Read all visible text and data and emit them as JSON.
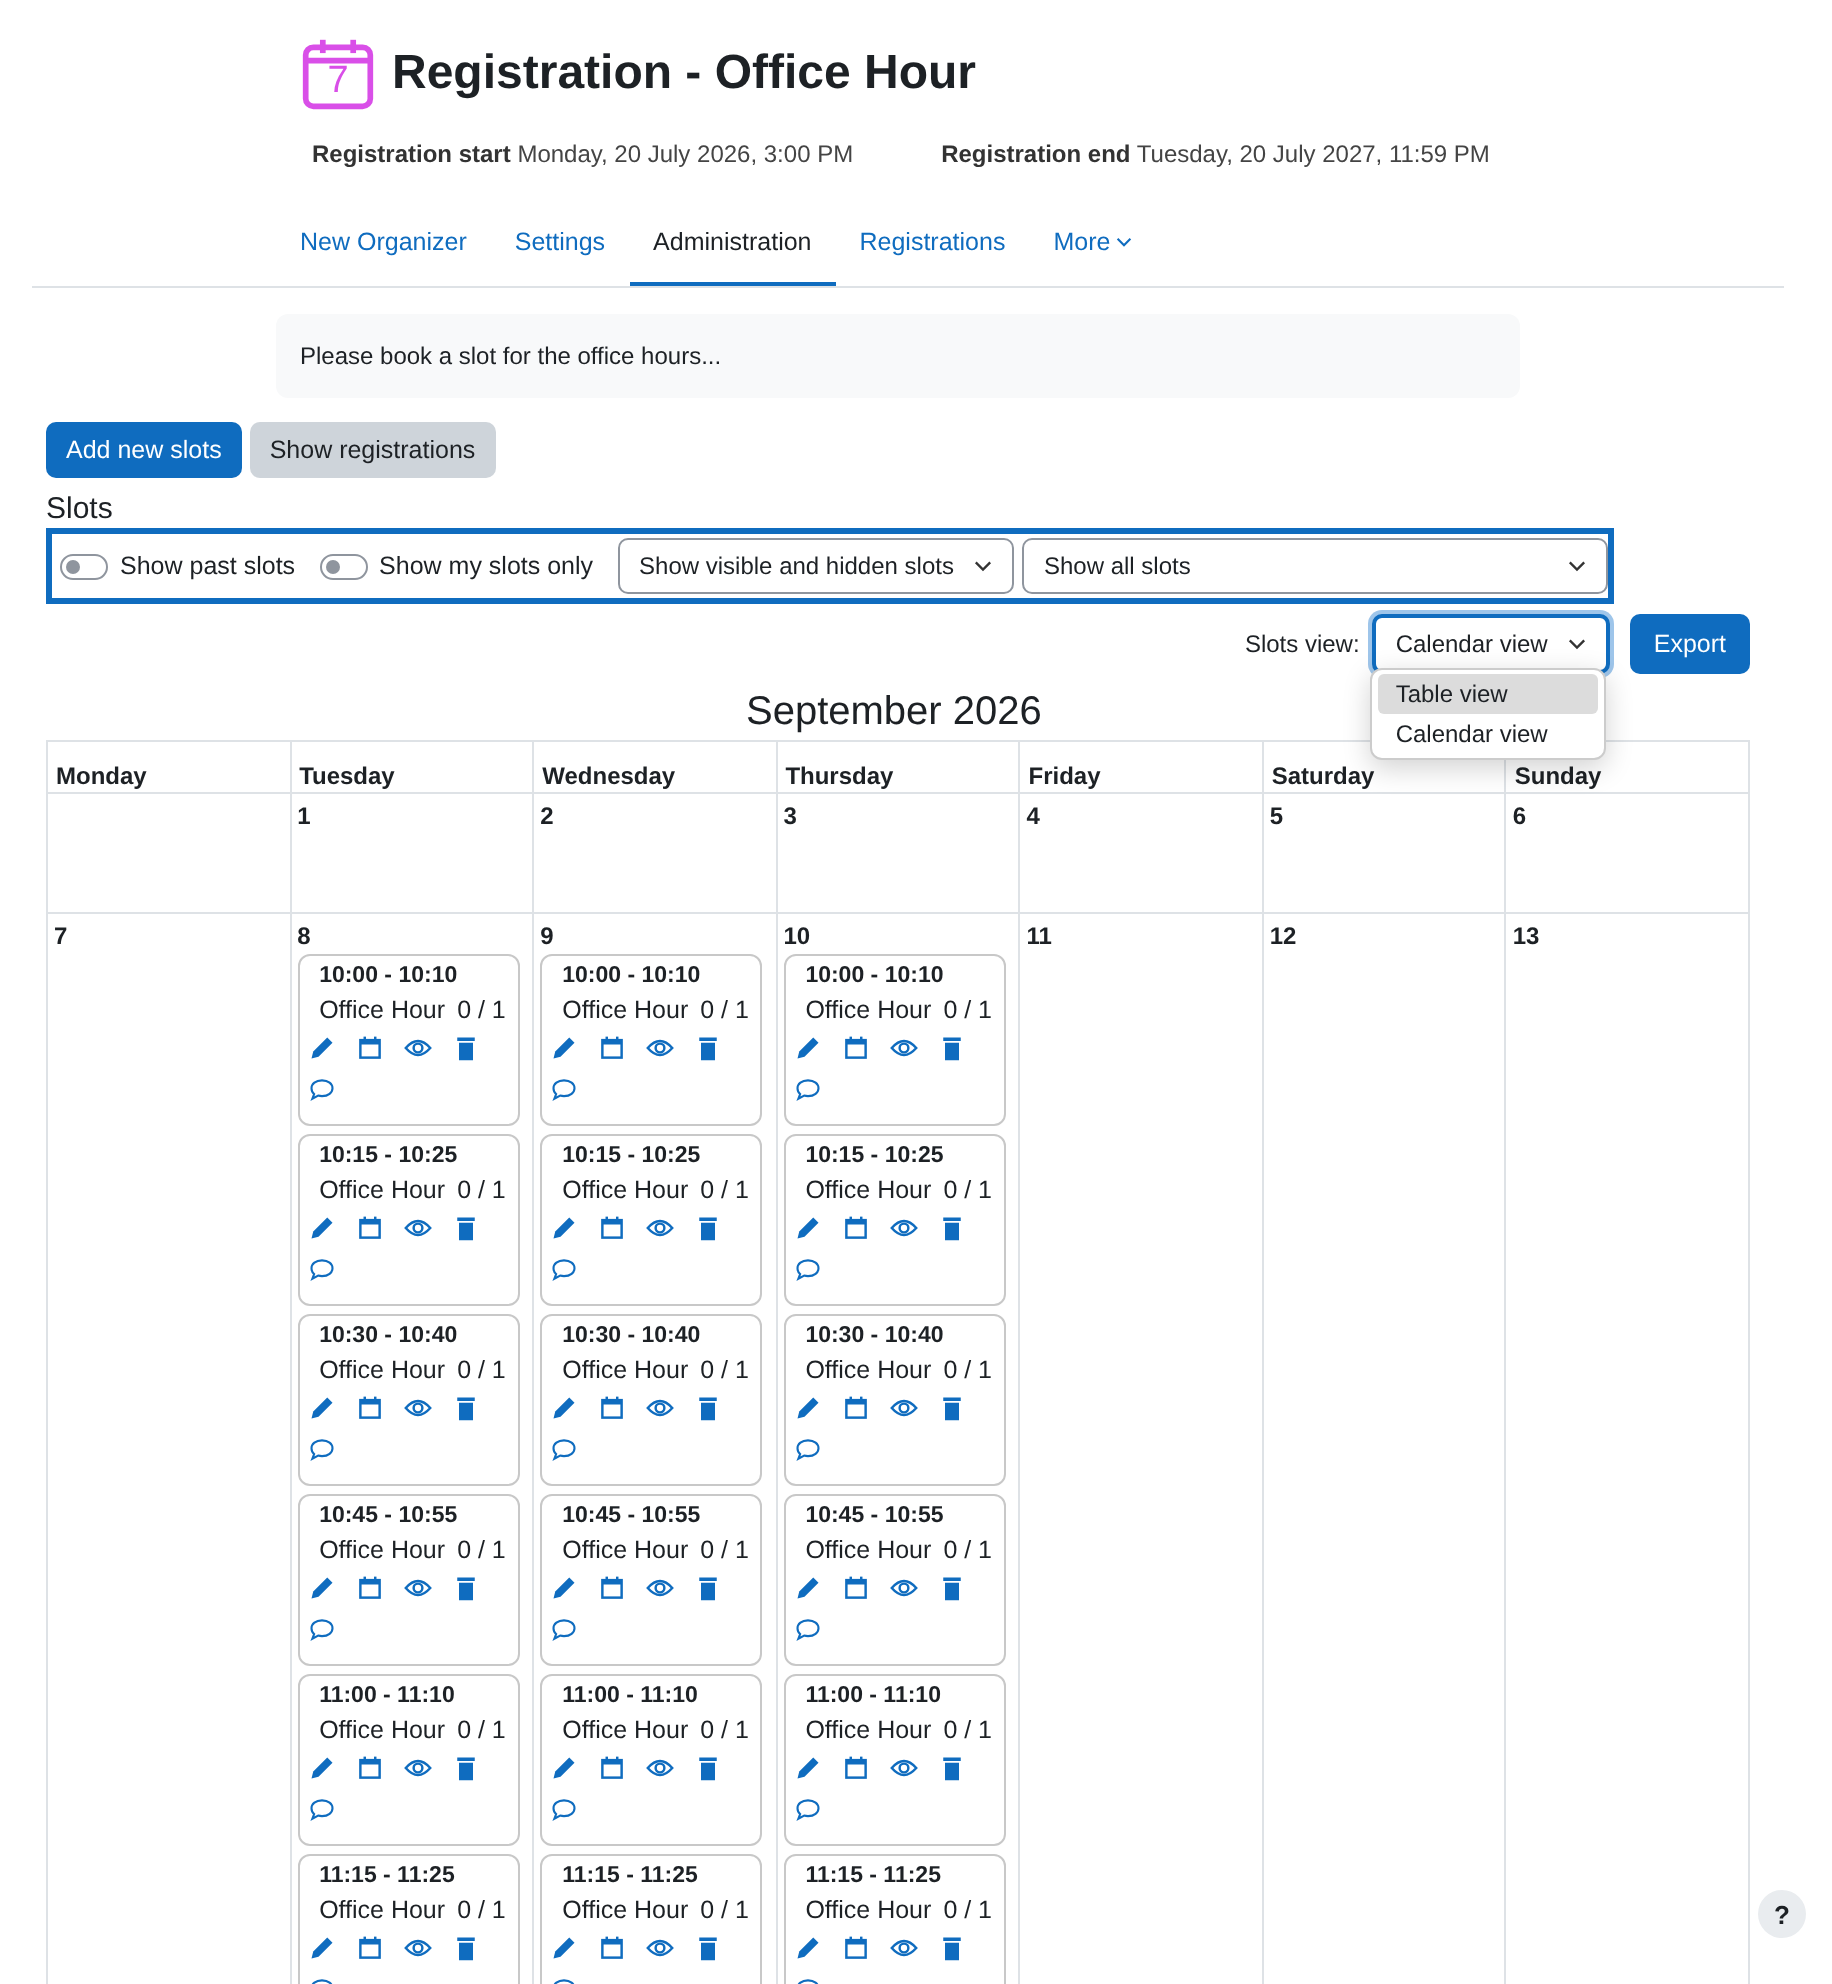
{
  "header": {
    "icon_text": "7",
    "title": "Registration - Office Hour"
  },
  "dates": [
    {
      "label": "Registration start",
      "value": "Monday, 20 July 2026, 3:00 PM"
    },
    {
      "label": "Registration end",
      "value": "Tuesday, 20 July 2027, 11:59 PM"
    }
  ],
  "tabs": [
    {
      "label": "New Organizer",
      "selected": false,
      "kind": "link"
    },
    {
      "label": "Settings",
      "selected": false,
      "kind": "link"
    },
    {
      "label": "Administration",
      "selected": true,
      "kind": "link"
    },
    {
      "label": "Registrations",
      "selected": false,
      "kind": "link"
    },
    {
      "label": "More",
      "selected": false,
      "kind": "menu"
    }
  ],
  "intro": "Please book a slot for the office hours...",
  "buttons": [
    {
      "label": "Add new slots",
      "kind": "primary"
    },
    {
      "label": "Show registrations",
      "kind": "secondary"
    }
  ],
  "slots_heading": "Slots",
  "filters": {
    "toggles": [
      {
        "label": "Show past slots",
        "on": false
      },
      {
        "label": "Show my slots only",
        "on": false
      }
    ],
    "selects": [
      {
        "value": "Show visible and hidden slots"
      },
      {
        "value": "Show all slots"
      }
    ]
  },
  "view": {
    "label": "Slots view:",
    "value": "Calendar view",
    "menu": [
      {
        "label": "Table view",
        "highlighted": true
      },
      {
        "label": "Calendar view",
        "highlighted": false
      }
    ]
  },
  "export": "Export",
  "calendar": {
    "title": "September 2026",
    "weekdays": [
      "Monday",
      "Tuesday",
      "Wednesday",
      "Thursday",
      "Friday",
      "Saturday",
      "Sunday"
    ],
    "weeks": [
      [
        {
          "day": "1"
        },
        {
          "day": "2"
        },
        {
          "day": "3"
        },
        {
          "day": "4"
        },
        {
          "day": "5"
        },
        {
          "day": "6"
        }
      ],
      [
        {
          "day": "7"
        },
        {
          "day": "8",
          "slots": [
            {
              "time": "10:00 - 10:10",
              "title": "Office Hour",
              "count": "0 / 1"
            },
            {
              "time": "10:15 - 10:25",
              "title": "Office Hour",
              "count": "0 / 1"
            },
            {
              "time": "10:30 - 10:40",
              "title": "Office Hour",
              "count": "0 / 1"
            },
            {
              "time": "10:45 - 10:55",
              "title": "Office Hour",
              "count": "0 / 1"
            },
            {
              "time": "11:00 - 11:10",
              "title": "Office Hour",
              "count": "0 / 1"
            },
            {
              "time": "11:15 - 11:25",
              "title": "Office Hour",
              "count": "0 / 1"
            }
          ]
        },
        {
          "day": "9",
          "slots": [
            {
              "time": "10:00 - 10:10",
              "title": "Office Hour",
              "count": "0 / 1"
            },
            {
              "time": "10:15 - 10:25",
              "title": "Office Hour",
              "count": "0 / 1"
            },
            {
              "time": "10:30 - 10:40",
              "title": "Office Hour",
              "count": "0 / 1"
            },
            {
              "time": "10:45 - 10:55",
              "title": "Office Hour",
              "count": "0 / 1"
            },
            {
              "time": "11:00 - 11:10",
              "title": "Office Hour",
              "count": "0 / 1"
            },
            {
              "time": "11:15 - 11:25",
              "title": "Office Hour",
              "count": "0 / 1"
            }
          ]
        },
        {
          "day": "10",
          "slots": [
            {
              "time": "10:00 - 10:10",
              "title": "Office Hour",
              "count": "0 / 1"
            },
            {
              "time": "10:15 - 10:25",
              "title": "Office Hour",
              "count": "0 / 1"
            },
            {
              "time": "10:30 - 10:40",
              "title": "Office Hour",
              "count": "0 / 1"
            },
            {
              "time": "10:45 - 10:55",
              "title": "Office Hour",
              "count": "0 / 1"
            },
            {
              "time": "11:00 - 11:10",
              "title": "Office Hour",
              "count": "0 / 1"
            },
            {
              "time": "11:15 - 11:25",
              "title": "Office Hour",
              "count": "0 / 1"
            }
          ]
        },
        {
          "day": "11"
        },
        {
          "day": "12"
        },
        {
          "day": "13"
        }
      ]
    ]
  },
  "help": "?"
}
